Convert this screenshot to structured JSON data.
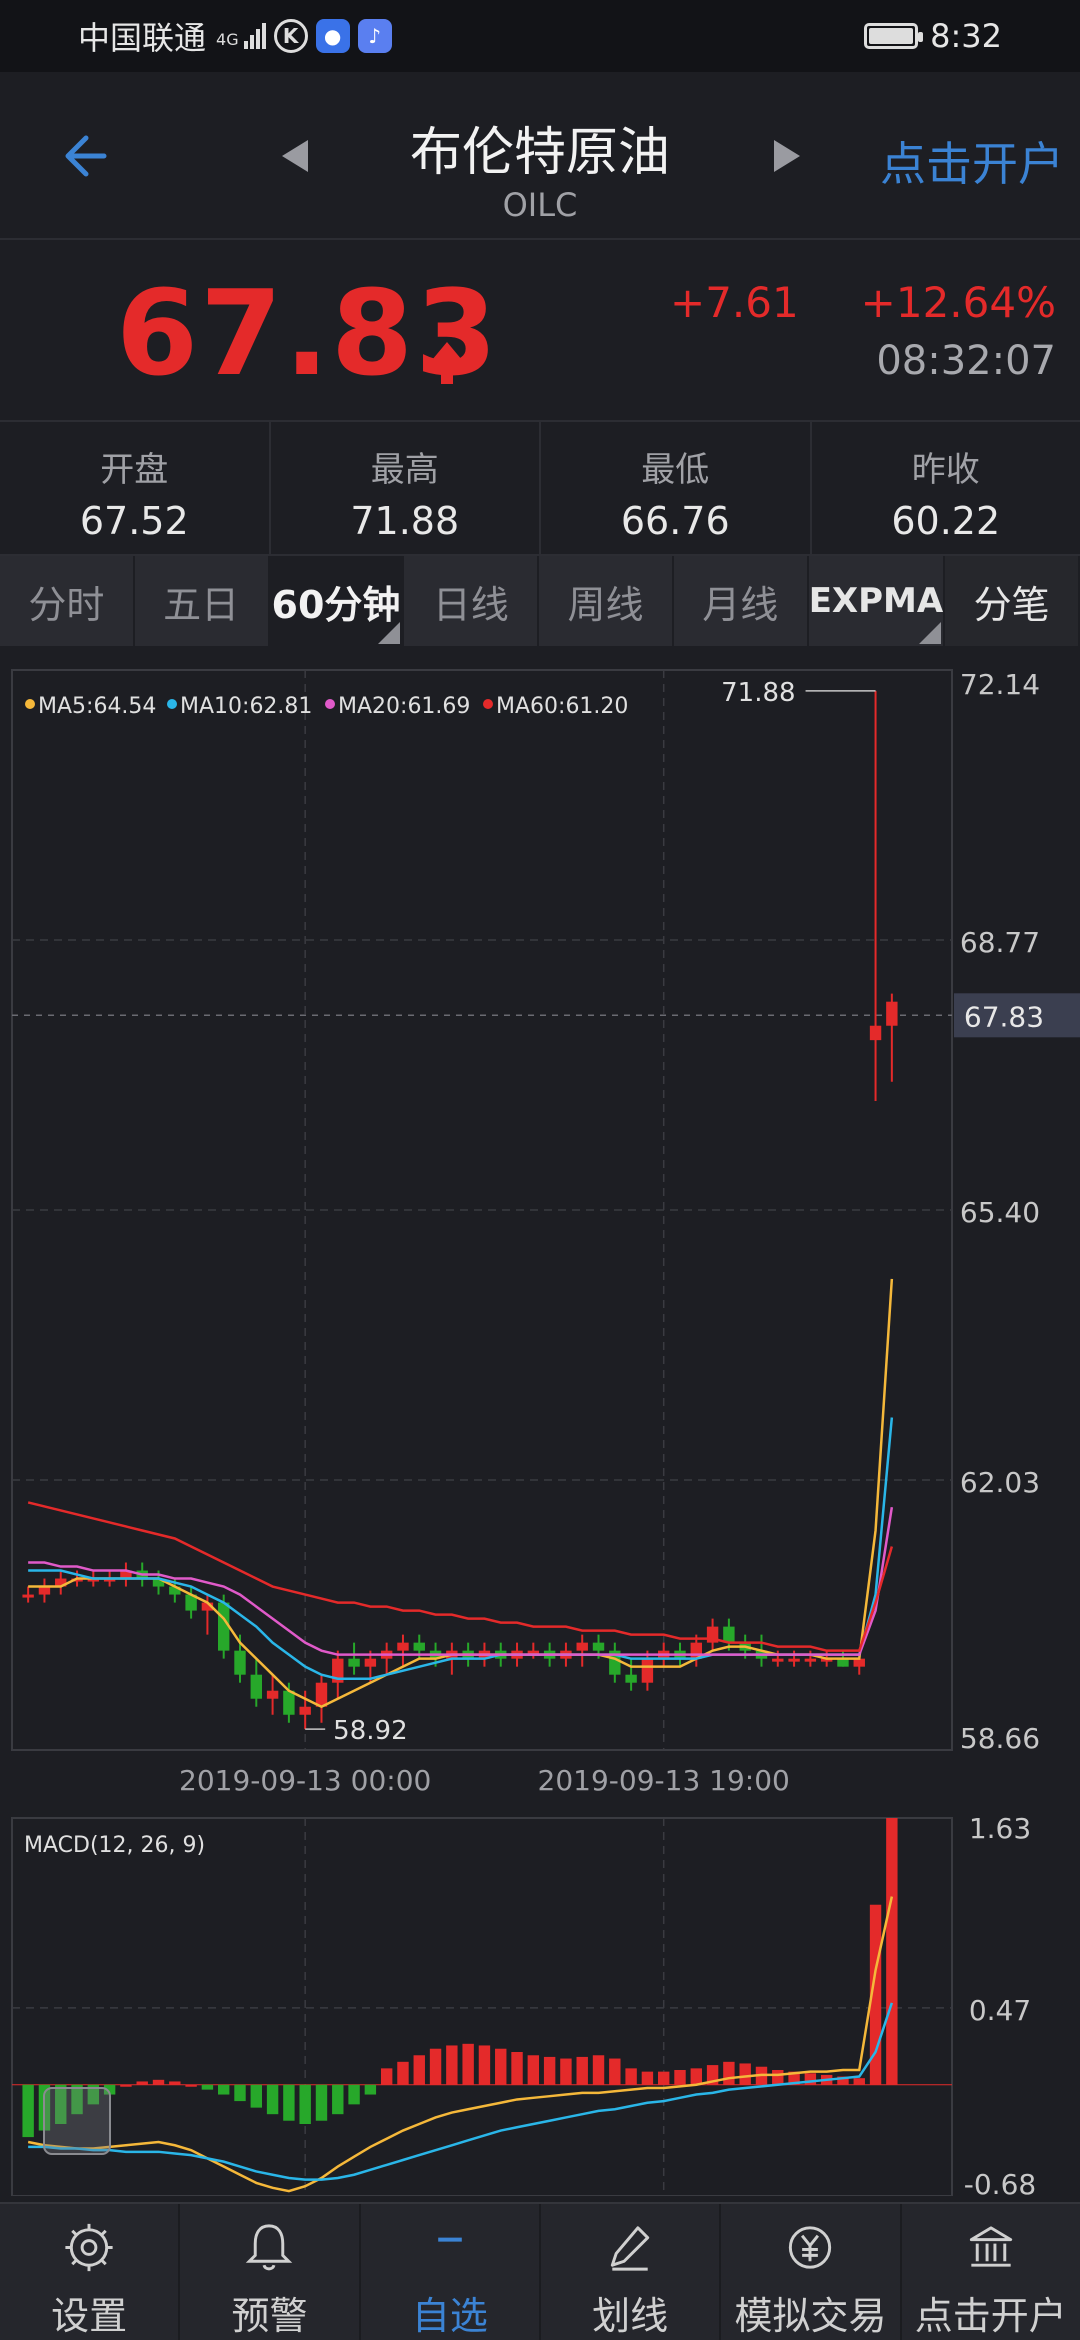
{
  "status_bar": {
    "carrier": "中国联通",
    "network": "4G",
    "time": "8:32"
  },
  "header": {
    "title": "布伦特原油",
    "code": "OILC",
    "open_account": "点击开户"
  },
  "quote": {
    "price": "67.83",
    "change": "+7.61",
    "change_pct": "+12.64%",
    "time": "08:32:07",
    "up_color": "#e42a2a"
  },
  "stats": [
    {
      "label": "开盘",
      "value": "67.52"
    },
    {
      "label": "最高",
      "value": "71.88"
    },
    {
      "label": "最低",
      "value": "66.76"
    },
    {
      "label": "昨收",
      "value": "60.22"
    }
  ],
  "tabs": [
    "分时",
    "五日",
    "60分钟",
    "日线",
    "周线",
    "月线",
    "EXPMA",
    "分笔"
  ],
  "active_tab": "60分钟",
  "chart_data": [
    {
      "type": "candlestick",
      "ylim": [
        58.66,
        72.14
      ],
      "y_ticks": [
        "72.14",
        "68.77",
        "65.40",
        "62.03",
        "58.66"
      ],
      "current_label": "67.83",
      "x_ticks": [
        "2019-09-13 00:00",
        "2019-09-13 19:00"
      ],
      "ma_legend": [
        {
          "label": "MA5:64.54",
          "color": "#f5b83a"
        },
        {
          "label": "MA10:62.81",
          "color": "#2ab6e8"
        },
        {
          "label": "MA20:61.69",
          "color": "#e05ac9"
        },
        {
          "label": "MA60:61.20",
          "color": "#e42a2a"
        }
      ],
      "high_annotation": "71.88",
      "low_annotation": "58.92",
      "candles": [
        [
          60.6,
          60.7,
          60.5,
          60.6
        ],
        [
          60.6,
          60.8,
          60.5,
          60.7
        ],
        [
          60.7,
          60.9,
          60.6,
          60.8
        ],
        [
          60.8,
          60.9,
          60.7,
          60.8
        ],
        [
          60.8,
          60.9,
          60.7,
          60.8
        ],
        [
          60.8,
          60.9,
          60.7,
          60.8
        ],
        [
          60.8,
          61.0,
          60.7,
          60.9
        ],
        [
          60.9,
          61.0,
          60.7,
          60.8
        ],
        [
          60.8,
          60.9,
          60.6,
          60.7
        ],
        [
          60.7,
          60.8,
          60.5,
          60.6
        ],
        [
          60.6,
          60.7,
          60.3,
          60.4
        ],
        [
          60.4,
          60.6,
          60.1,
          60.5
        ],
        [
          60.5,
          60.6,
          59.8,
          59.9
        ],
        [
          59.9,
          60.1,
          59.5,
          59.6
        ],
        [
          59.6,
          59.8,
          59.2,
          59.3
        ],
        [
          59.3,
          59.6,
          59.1,
          59.4
        ],
        [
          59.4,
          59.5,
          59.0,
          59.1
        ],
        [
          59.1,
          59.4,
          58.92,
          59.2
        ],
        [
          59.2,
          59.6,
          59.0,
          59.5
        ],
        [
          59.5,
          59.9,
          59.3,
          59.8
        ],
        [
          59.8,
          60.0,
          59.6,
          59.7
        ],
        [
          59.7,
          59.9,
          59.5,
          59.8
        ],
        [
          59.8,
          60.0,
          59.6,
          59.9
        ],
        [
          59.9,
          60.1,
          59.7,
          60.0
        ],
        [
          60.0,
          60.1,
          59.8,
          59.9
        ],
        [
          59.9,
          60.0,
          59.7,
          59.8
        ],
        [
          59.8,
          60.0,
          59.6,
          59.9
        ],
        [
          59.9,
          60.0,
          59.7,
          59.8
        ],
        [
          59.8,
          60.0,
          59.7,
          59.9
        ],
        [
          59.9,
          60.0,
          59.7,
          59.8
        ],
        [
          59.8,
          60.0,
          59.7,
          59.9
        ],
        [
          59.9,
          60.0,
          59.8,
          59.9
        ],
        [
          59.9,
          60.0,
          59.7,
          59.8
        ],
        [
          59.8,
          60.0,
          59.7,
          59.9
        ],
        [
          59.9,
          60.1,
          59.7,
          60.0
        ],
        [
          60.0,
          60.1,
          59.8,
          59.9
        ],
        [
          59.9,
          60.0,
          59.5,
          59.6
        ],
        [
          59.6,
          59.8,
          59.4,
          59.5
        ],
        [
          59.5,
          59.9,
          59.4,
          59.8
        ],
        [
          59.8,
          60.0,
          59.7,
          59.9
        ],
        [
          59.9,
          60.0,
          59.7,
          59.8
        ],
        [
          59.8,
          60.1,
          59.7,
          60.0
        ],
        [
          60.0,
          60.3,
          59.9,
          60.2
        ],
        [
          60.2,
          60.3,
          59.9,
          60.0
        ],
        [
          60.0,
          60.1,
          59.8,
          59.9
        ],
        [
          59.9,
          60.1,
          59.7,
          59.8
        ],
        [
          59.8,
          59.9,
          59.7,
          59.8
        ],
        [
          59.8,
          59.9,
          59.7,
          59.8
        ],
        [
          59.8,
          59.9,
          59.7,
          59.8
        ],
        [
          59.8,
          59.9,
          59.7,
          59.8
        ],
        [
          59.8,
          59.9,
          59.7,
          59.7
        ],
        [
          59.7,
          59.8,
          59.6,
          59.8
        ],
        [
          67.52,
          71.88,
          66.76,
          67.7
        ],
        [
          67.7,
          68.1,
          67.0,
          68.0
        ]
      ],
      "ma5": [
        60.7,
        60.7,
        60.7,
        60.8,
        60.8,
        60.8,
        60.8,
        60.8,
        60.8,
        60.7,
        60.6,
        60.5,
        60.3,
        60.0,
        59.8,
        59.6,
        59.4,
        59.3,
        59.2,
        59.3,
        59.4,
        59.5,
        59.6,
        59.7,
        59.8,
        59.8,
        59.85,
        59.85,
        59.85,
        59.85,
        59.85,
        59.85,
        59.85,
        59.85,
        59.85,
        59.85,
        59.8,
        59.7,
        59.7,
        59.7,
        59.7,
        59.8,
        59.9,
        59.95,
        59.95,
        59.9,
        59.85,
        59.85,
        59.85,
        59.8,
        59.8,
        59.8,
        61.4,
        64.54
      ],
      "ma10": [
        60.9,
        60.9,
        60.9,
        60.85,
        60.8,
        60.8,
        60.8,
        60.8,
        60.8,
        60.75,
        60.7,
        60.6,
        60.5,
        60.35,
        60.2,
        60.0,
        59.85,
        59.7,
        59.6,
        59.55,
        59.55,
        59.55,
        59.6,
        59.65,
        59.7,
        59.75,
        59.8,
        59.8,
        59.8,
        59.85,
        59.85,
        59.85,
        59.85,
        59.85,
        59.85,
        59.85,
        59.85,
        59.8,
        59.8,
        59.8,
        59.8,
        59.8,
        59.85,
        59.85,
        59.85,
        59.85,
        59.85,
        59.85,
        59.85,
        59.85,
        59.85,
        59.85,
        60.6,
        62.81
      ],
      "ma20": [
        61.0,
        61.0,
        60.95,
        60.95,
        60.9,
        60.9,
        60.9,
        60.85,
        60.85,
        60.8,
        60.8,
        60.75,
        60.7,
        60.6,
        60.45,
        60.3,
        60.15,
        60.0,
        59.9,
        59.85,
        59.85,
        59.85,
        59.85,
        59.85,
        59.85,
        59.85,
        59.85,
        59.85,
        59.85,
        59.85,
        59.85,
        59.85,
        59.85,
        59.85,
        59.85,
        59.85,
        59.85,
        59.85,
        59.85,
        59.85,
        59.85,
        59.85,
        59.85,
        59.85,
        59.85,
        59.85,
        59.85,
        59.85,
        59.85,
        59.85,
        59.85,
        59.85,
        60.4,
        61.69
      ],
      "ma60": [
        61.75,
        61.7,
        61.65,
        61.6,
        61.55,
        61.5,
        61.45,
        61.4,
        61.35,
        61.3,
        61.2,
        61.1,
        61.0,
        60.9,
        60.8,
        60.7,
        60.65,
        60.6,
        60.55,
        60.5,
        60.5,
        60.45,
        60.45,
        60.4,
        60.4,
        60.35,
        60.35,
        60.3,
        60.3,
        60.25,
        60.25,
        60.2,
        60.2,
        60.2,
        60.15,
        60.15,
        60.15,
        60.1,
        60.1,
        60.1,
        60.05,
        60.05,
        60.05,
        60.0,
        60.0,
        60.0,
        59.95,
        59.95,
        59.95,
        59.9,
        59.9,
        59.9,
        60.5,
        61.2
      ]
    },
    {
      "type": "bar",
      "title": "MACD(12, 26, 9)",
      "ylim": [
        -0.68,
        1.63
      ],
      "y_ticks": [
        "1.63",
        "0.47",
        "-0.68"
      ],
      "hist": [
        -0.32,
        -0.28,
        -0.24,
        -0.18,
        -0.12,
        -0.06,
        0.0,
        0.02,
        0.03,
        0.02,
        0.0,
        -0.03,
        -0.06,
        -0.1,
        -0.14,
        -0.18,
        -0.22,
        -0.24,
        -0.22,
        -0.18,
        -0.12,
        -0.06,
        0.1,
        0.14,
        0.18,
        0.22,
        0.24,
        0.25,
        0.24,
        0.22,
        0.2,
        0.18,
        0.17,
        0.16,
        0.17,
        0.18,
        0.16,
        0.1,
        0.08,
        0.08,
        0.09,
        0.1,
        0.12,
        0.14,
        0.13,
        0.11,
        0.09,
        0.08,
        0.07,
        0.06,
        0.05,
        0.04,
        1.1,
        1.63
      ],
      "dif": [
        -0.35,
        -0.37,
        -0.38,
        -0.39,
        -0.39,
        -0.38,
        -0.37,
        -0.36,
        -0.35,
        -0.37,
        -0.4,
        -0.45,
        -0.5,
        -0.55,
        -0.6,
        -0.63,
        -0.65,
        -0.62,
        -0.57,
        -0.5,
        -0.44,
        -0.38,
        -0.33,
        -0.28,
        -0.24,
        -0.2,
        -0.17,
        -0.15,
        -0.13,
        -0.11,
        -0.09,
        -0.08,
        -0.07,
        -0.06,
        -0.05,
        -0.05,
        -0.04,
        -0.03,
        -0.02,
        -0.02,
        -0.01,
        0.0,
        0.02,
        0.04,
        0.05,
        0.06,
        0.06,
        0.07,
        0.08,
        0.08,
        0.09,
        0.09,
        0.7,
        1.15
      ],
      "dea": [
        -0.38,
        -0.38,
        -0.39,
        -0.39,
        -0.4,
        -0.4,
        -0.41,
        -0.41,
        -0.41,
        -0.42,
        -0.43,
        -0.45,
        -0.47,
        -0.5,
        -0.53,
        -0.55,
        -0.57,
        -0.58,
        -0.58,
        -0.57,
        -0.55,
        -0.52,
        -0.49,
        -0.46,
        -0.43,
        -0.4,
        -0.37,
        -0.34,
        -0.31,
        -0.28,
        -0.26,
        -0.24,
        -0.22,
        -0.2,
        -0.18,
        -0.16,
        -0.15,
        -0.13,
        -0.11,
        -0.1,
        -0.08,
        -0.06,
        -0.05,
        -0.03,
        -0.02,
        -0.01,
        0.0,
        0.01,
        0.02,
        0.03,
        0.04,
        0.05,
        0.2,
        0.5
      ]
    }
  ],
  "bottom_nav": [
    {
      "label": "设置",
      "icon": "gear-icon"
    },
    {
      "label": "预警",
      "icon": "bell-icon"
    },
    {
      "label": "自选",
      "icon": "minus-icon"
    },
    {
      "label": "划线",
      "icon": "pen-icon"
    },
    {
      "label": "模拟交易",
      "icon": "yen-icon"
    },
    {
      "label": "点击开户",
      "icon": "bank-icon"
    }
  ],
  "active_nav": "自选"
}
